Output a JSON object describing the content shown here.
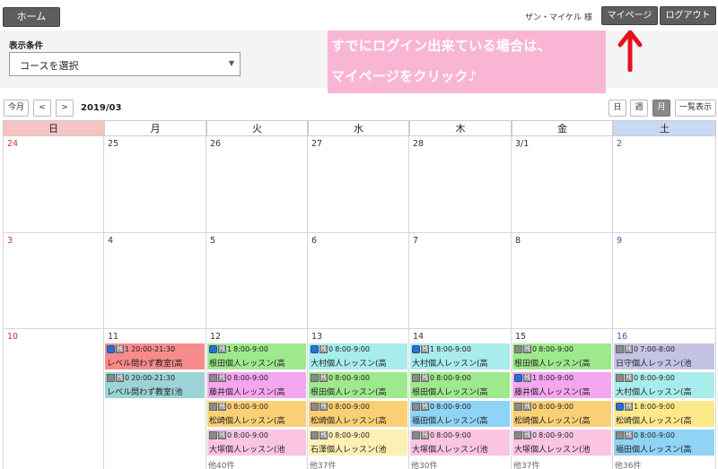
{
  "header": {
    "home_label": "ホーム",
    "user_name": "ザン・マイケル 様",
    "mypage_label": "マイページ",
    "logout_label": "ログアウト"
  },
  "filter": {
    "label": "表示条件",
    "course_select": "コースを選択"
  },
  "annotation": {
    "line1": "すでにログイン出来ている場合は、",
    "line2": "マイページをクリック♪",
    "arrow_color": "#e8101e"
  },
  "calendar_nav": {
    "today": "今月",
    "prev": "<",
    "next": ">",
    "month": "2019/03",
    "views": [
      "日",
      "週",
      "月",
      "一覧表示"
    ],
    "selected_view": "月"
  },
  "weekdays": [
    "日",
    "月",
    "火",
    "水",
    "木",
    "金",
    "土"
  ],
  "weeks": [
    {
      "days": [
        "24",
        "25",
        "26",
        "27",
        "28",
        "3/1",
        "2"
      ]
    },
    {
      "days": [
        "3",
        "4",
        "5",
        "6",
        "7",
        "8",
        "9"
      ]
    },
    {
      "days": [
        "10",
        "11",
        "12",
        "13",
        "14",
        "15",
        "16"
      ]
    }
  ],
  "events": {
    "mon": [
      {
        "icon": "gray",
        "rem": "1",
        "time": "20:00-21:30",
        "name": "レベル問わず教室(高",
        "color": "red",
        "icon_type": "b"
      },
      {
        "icon": "gray",
        "rem": "0",
        "time": "20:00-21:30",
        "name": "レベル問わず教室(池",
        "color": "teal",
        "icon_type": "g"
      }
    ],
    "tue": [
      {
        "rem": "1",
        "time": "8:00-9:00",
        "name": "根田個人レッスン(高",
        "color": "green",
        "icon_type": "b"
      },
      {
        "rem": "0",
        "time": "8:00-9:00",
        "name": "藤井個人レッスン(高",
        "color": "pink",
        "icon_type": "g"
      },
      {
        "rem": "0",
        "time": "8:00-9:00",
        "name": "松崎個人レッスン(高",
        "color": "orange",
        "icon_type": "g"
      },
      {
        "rem": "0",
        "time": "8:00-9:00",
        "name": "大塚個人レッスン(池",
        "color": "lightpink",
        "icon_type": "g"
      }
    ],
    "wed": [
      {
        "rem": "0",
        "time": "8:00-9:00",
        "name": "大村個人レッスン(高",
        "color": "cyan",
        "icon_type": "b"
      },
      {
        "rem": "0",
        "time": "8:00-9:00",
        "name": "根田個人レッスン(高",
        "color": "green",
        "icon_type": "g"
      },
      {
        "rem": "0",
        "time": "8:00-9:00",
        "name": "松崎個人レッスン(高",
        "color": "orange",
        "icon_type": "g"
      },
      {
        "rem": "0",
        "time": "8:00-9:00",
        "name": "石澤個人レッスン(池",
        "color": "lightyellow",
        "icon_type": "g"
      }
    ],
    "thu": [
      {
        "rem": "1",
        "time": "8:00-9:00",
        "name": "大村個人レッスン(高",
        "color": "cyan",
        "icon_type": "b"
      },
      {
        "rem": "0",
        "time": "8:00-9:00",
        "name": "根田個人レッスン(高",
        "color": "green",
        "icon_type": "g"
      },
      {
        "rem": "0",
        "time": "8:00-9:00",
        "name": "福田個人レッスン(高",
        "color": "blue",
        "icon_type": "g"
      },
      {
        "rem": "0",
        "time": "8:00-9:00",
        "name": "大塚個人レッスン(池",
        "color": "lightpink",
        "icon_type": "g"
      }
    ],
    "fri": [
      {
        "rem": "0",
        "time": "8:00-9:00",
        "name": "根田個人レッスン(高",
        "color": "green",
        "icon_type": "g"
      },
      {
        "rem": "1",
        "time": "8:00-9:00",
        "name": "藤井個人レッスン(高",
        "color": "pink",
        "icon_type": "b"
      },
      {
        "rem": "0",
        "time": "8:00-9:00",
        "name": "松崎個人レッスン(高",
        "color": "orange",
        "icon_type": "g"
      },
      {
        "rem": "0",
        "time": "8:00-9:00",
        "name": "大塚個人レッスン(池",
        "color": "lightpink",
        "icon_type": "g"
      }
    ],
    "sat": [
      {
        "rem": "0",
        "time": "7:00-8:00",
        "name": "日守個人レッスン(池",
        "color": "lavender",
        "icon_type": "g"
      },
      {
        "rem": "0",
        "time": "8:00-9:00",
        "name": "大村個人レッスン(高",
        "color": "cyan",
        "icon_type": "g"
      },
      {
        "rem": "1",
        "time": "8:00-9:00",
        "name": "松崎個人レッスン(高",
        "color": "yellow",
        "icon_type": "b"
      },
      {
        "rem": "0",
        "time": "8:00-9:00",
        "name": "福田個人レッスン(高",
        "color": "blue",
        "icon_type": "g"
      }
    ]
  },
  "remain_label": "残",
  "more_counts": {
    "tue": "他40件",
    "wed": "他37件",
    "thu": "他30件",
    "fri": "他37件",
    "sat": "他36件"
  }
}
